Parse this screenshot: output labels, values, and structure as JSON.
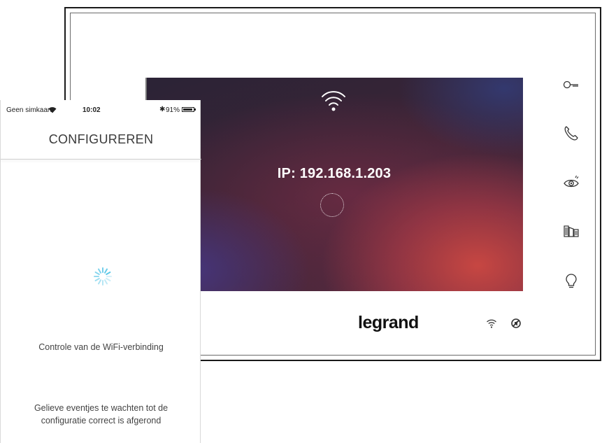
{
  "device": {
    "screen": {
      "ip_text": "IP: 192.168.1.203"
    },
    "brand": "legrand",
    "side_icons": [
      "key-icon",
      "phone-icon",
      "eye-icon",
      "gate-icon",
      "light-bulb-icon"
    ],
    "status_icons": [
      "wifi-icon",
      "mute-icon"
    ]
  },
  "phone": {
    "statusbar": {
      "carrier": "Geen simkaart",
      "time": "10:02",
      "bluetooth": "✱",
      "battery_pct": "91%",
      "battery_level": 0.91
    },
    "title": "CONFIGUREREN",
    "check_text": "Controle van de WiFi-verbinding",
    "wait_text": "Gelieve eventjes te wachten tot de configuratie correct is afgerond"
  },
  "colors": {
    "spinner": "#5ec8e8",
    "screen_accent": "#c94a44"
  }
}
